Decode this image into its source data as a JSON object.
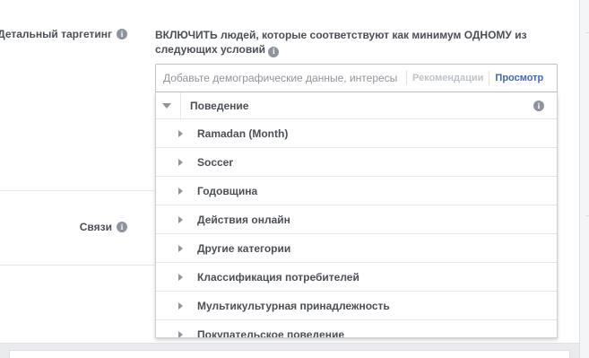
{
  "targeting": {
    "label": "Детальный таргетинг",
    "info_icon": "info-icon",
    "include_text": "ВКЛЮЧИТЬ людей, которые соответствуют как минимум ОДНОМУ из следующих условий",
    "search": {
      "placeholder": "Добавьте демографические данные, интересы",
      "value": ""
    },
    "tabs": {
      "recommendations": "Рекомендации",
      "browse": "Просмотр"
    }
  },
  "links": {
    "label": "Связи",
    "info_icon": "info-icon"
  },
  "dropdown": {
    "header": "Поведение",
    "items": [
      {
        "label": "Ramadan (Month)"
      },
      {
        "label": "Soccer"
      },
      {
        "label": "Годовщина"
      },
      {
        "label": "Действия онлайн"
      },
      {
        "label": "Другие категории"
      },
      {
        "label": "Классификация потребителей"
      },
      {
        "label": "Мультикультурная принадлежность"
      },
      {
        "label": "Покупательское поведение"
      }
    ]
  },
  "colors": {
    "accent": "#4267b2",
    "text": "#4b4f56",
    "muted": "#90949c",
    "border": "#dddfe2"
  }
}
